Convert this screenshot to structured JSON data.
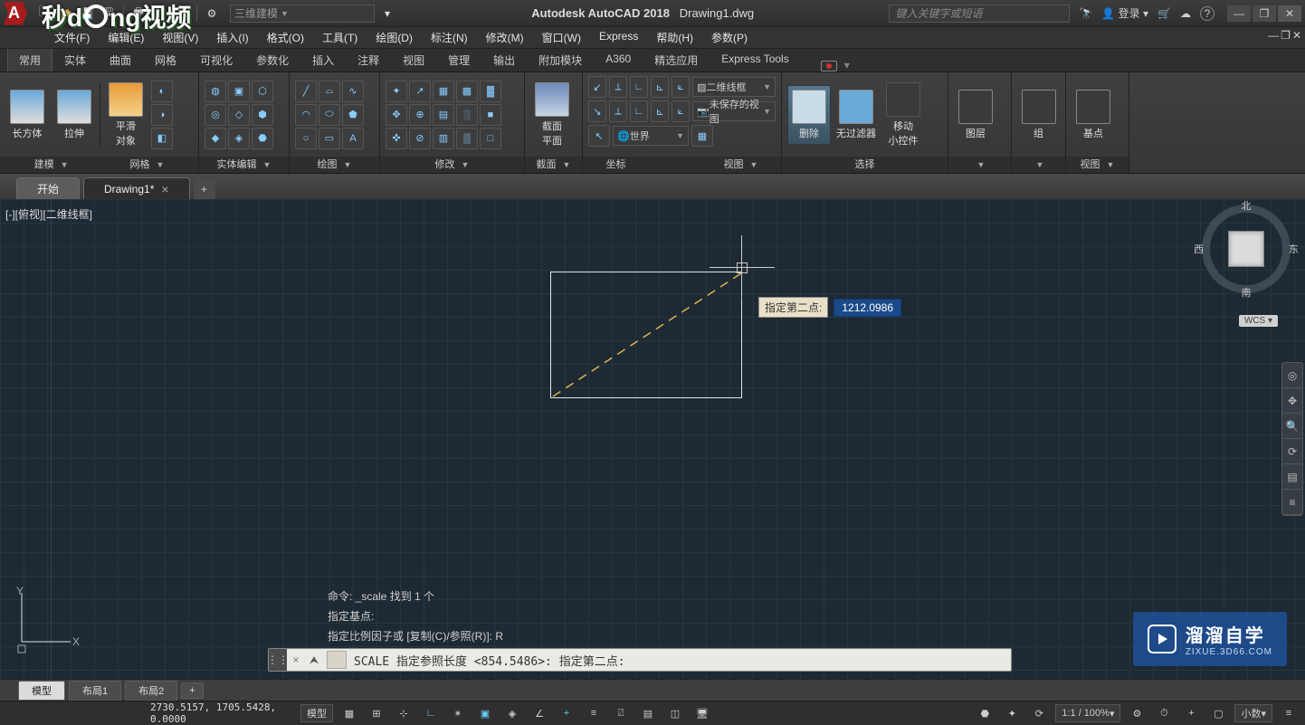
{
  "app": {
    "title_prefix": "Autodesk AutoCAD 2018",
    "document": "Drawing1.dwg"
  },
  "search_placeholder": "键入关键字或短语",
  "login_label": "登录",
  "workspace_select": "三维建模",
  "menus": [
    "文件(F)",
    "编辑(E)",
    "视图(V)",
    "插入(I)",
    "格式(O)",
    "工具(T)",
    "绘图(D)",
    "标注(N)",
    "修改(M)",
    "窗口(W)",
    "Express",
    "帮助(H)",
    "参数(P)"
  ],
  "ribbon_tabs": [
    "常用",
    "实体",
    "曲面",
    "网格",
    "可视化",
    "参数化",
    "插入",
    "注释",
    "视图",
    "管理",
    "输出",
    "附加模块",
    "A360",
    "精选应用",
    "Express Tools"
  ],
  "ribbon_active": 0,
  "panels": {
    "modeling": {
      "title": "建模",
      "tools": [
        {
          "label": "长方体"
        },
        {
          "label": "拉伸"
        },
        {
          "label": "平滑对象",
          "sub": "平滑\n对象"
        }
      ]
    },
    "mesh": {
      "title": "网格"
    },
    "solidedit": {
      "title": "实体编辑"
    },
    "draw": {
      "title": "绘图"
    },
    "modify": {
      "title": "修改"
    },
    "section": {
      "title": "截面",
      "tool": "截面平面",
      "sub": "截面\n平面"
    },
    "coord": {
      "title": "坐标",
      "world": "世界",
      "vstyle": "二维线框",
      "vsave": "未保存的视图"
    },
    "view": {
      "title": "视图",
      "del": "删除",
      "nofilter": "无过滤器",
      "mwidget": "移动小控件",
      "sub": "移动\n小控件"
    },
    "select": {
      "title": "选择"
    },
    "layer": {
      "title": "图层",
      "tool": "图层"
    },
    "group": {
      "title": "组",
      "tool": "组"
    },
    "base": {
      "title": "基点",
      "tool": "基点"
    },
    "view2": {
      "title": "视图"
    }
  },
  "draw_tabs": {
    "start": "开始",
    "doc": "Drawing1*"
  },
  "viewport_label": "[-][俯视][二维线框]",
  "compass": {
    "n": "北",
    "s": "南",
    "e": "东",
    "w": "西"
  },
  "wcs": "WCS",
  "tooltip": {
    "label": "指定第二点:",
    "value": "1212.0986"
  },
  "cmd_log": [
    "命令: _scale 找到 1 个",
    "指定基点:",
    "指定比例因子或 [复制(C)/参照(R)]: R"
  ],
  "cmd_line": "SCALE 指定参照长度 <854.5486>:   指定第二点:",
  "layouts": [
    "模型",
    "布局1",
    "布局2"
  ],
  "status": {
    "coords": "2730.5157, 1705.5428, 0.0000",
    "model": "模型",
    "scale": "1:1 / 100%",
    "prec": "小数"
  },
  "watermark": {
    "t1": "溜溜自学",
    "t2": "ZIXUE.3D66.COM"
  },
  "overlay_logo_a": "秒d",
  "overlay_logo_b": "ng视频"
}
